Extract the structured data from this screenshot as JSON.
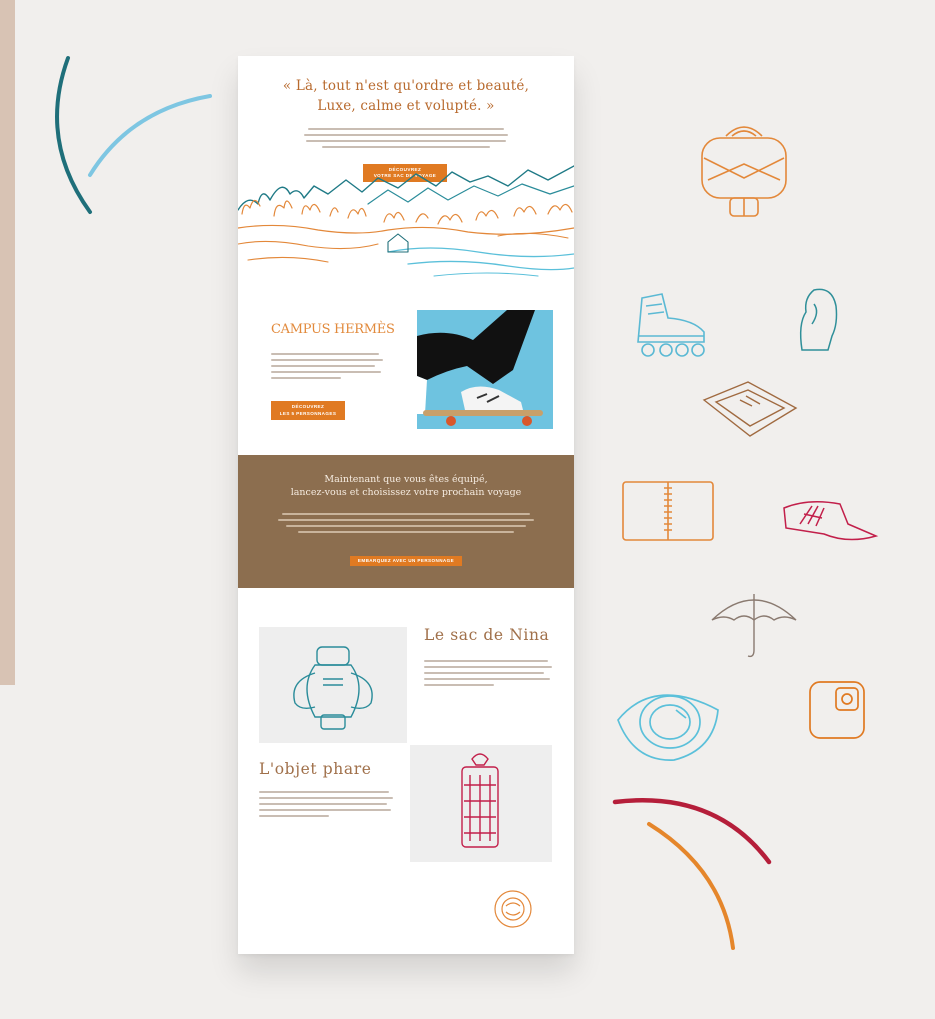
{
  "hero": {
    "quote_line1": "« Là, tout n'est qu'ordre et beauté,",
    "quote_line2": "Luxe, calme et volupté. »",
    "button_line1": "DÉCOUVREZ",
    "button_line2": "VOTRE SAC DE VOYAGE"
  },
  "campus": {
    "title": "CAMPUS HERMÈS",
    "button_line1": "DÉCOUVREZ",
    "button_line2": "LES 5 PERSONNAGES"
  },
  "journey": {
    "title_line1": "Maintenant que vous êtes équipé,",
    "title_line2": "lancez-vous et choisissez votre prochain voyage",
    "button": "EMBARQUEZ AVEC UN PERSONNAGE"
  },
  "nina": {
    "title": "Le sac de Nina"
  },
  "phare": {
    "title": "L'objet phare"
  },
  "colors": {
    "page_bg": "#f1efed",
    "accent_orange": "#e07a22",
    "teal": "#1f6f7a",
    "sky": "#6ec3e0",
    "brown": "#8c6e4f",
    "crimson": "#b51e3a"
  },
  "icons": [
    "travel-bag-icon",
    "roller-skate-icon",
    "horse-head-icon",
    "tray-icon",
    "notebook-icon",
    "visor-cap-icon",
    "umbrella-icon",
    "eye-icon",
    "square-logo-icon",
    "seal-badge-icon"
  ]
}
